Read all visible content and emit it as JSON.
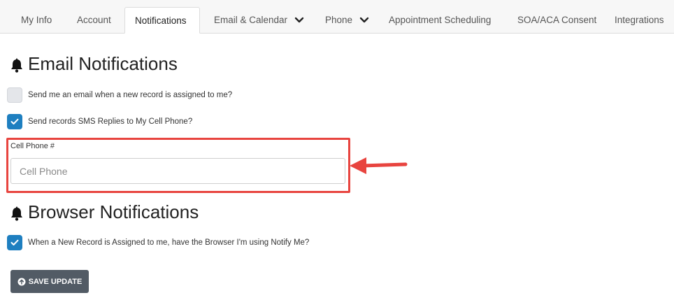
{
  "tabs": [
    {
      "label": "My Info",
      "active": false,
      "dropdown": false
    },
    {
      "label": "Account",
      "active": false,
      "dropdown": false
    },
    {
      "label": "Notifications",
      "active": true,
      "dropdown": false
    },
    {
      "label": "Email & Calendar",
      "active": false,
      "dropdown": true
    },
    {
      "label": "Phone",
      "active": false,
      "dropdown": true
    },
    {
      "label": "Appointment Scheduling",
      "active": false,
      "dropdown": false
    },
    {
      "label": "SOA/ACA Consent",
      "active": false,
      "dropdown": false
    },
    {
      "label": "Integrations",
      "active": false,
      "dropdown": false
    }
  ],
  "email_section": {
    "title": "Email Notifications",
    "icon": "bell-icon",
    "options": [
      {
        "label": "Send me an email when a new record is assigned to me?",
        "checked": false
      },
      {
        "label": "Send records SMS Replies to My Cell Phone?",
        "checked": true
      }
    ],
    "cell_phone": {
      "label": "Cell Phone #",
      "placeholder": "Cell Phone",
      "value": ""
    }
  },
  "browser_section": {
    "title": "Browser Notifications",
    "icon": "bell-icon",
    "options": [
      {
        "label": "When a New Record is Assigned to me, have the Browser I'm using Notify Me?",
        "checked": true
      }
    ]
  },
  "save_button": {
    "label": "SAVE UPDATE",
    "icon": "arrow-circle-up-icon"
  },
  "colors": {
    "checkbox_checked": "#1e7fc0",
    "highlight": "#e8443f",
    "button": "#525b65"
  }
}
